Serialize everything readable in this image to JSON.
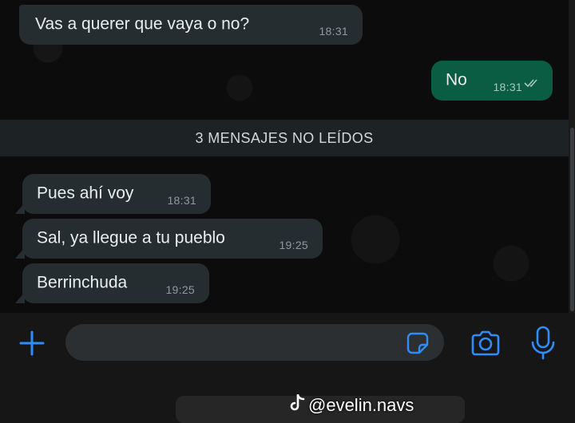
{
  "messages": [
    {
      "text": "Vas a querer que vaya o no?",
      "time": "18:31"
    },
    {
      "text": "No",
      "time": "18:31"
    },
    {
      "text": "Pues ahí voy",
      "time": "18:31"
    },
    {
      "text": "Sal, ya llegue a tu pueblo",
      "time": "19:25"
    },
    {
      "text": "Berrinchuda",
      "time": "19:25"
    }
  ],
  "unread_banner": "3 MENSAJES NO LEÍDOS",
  "input": {
    "placeholder": ""
  },
  "icons": {
    "add": "plus-icon",
    "sticker": "sticker-icon",
    "camera": "camera-icon",
    "mic": "microphone-icon",
    "read_receipt": "double-check-icon",
    "tiktok": "tiktok-icon"
  },
  "watermark": {
    "handle": "@evelin.navs"
  },
  "colors": {
    "accent": "#2f8cff",
    "outgoing_bubble": "#0a5c43",
    "incoming_bubble": "#262d31"
  }
}
